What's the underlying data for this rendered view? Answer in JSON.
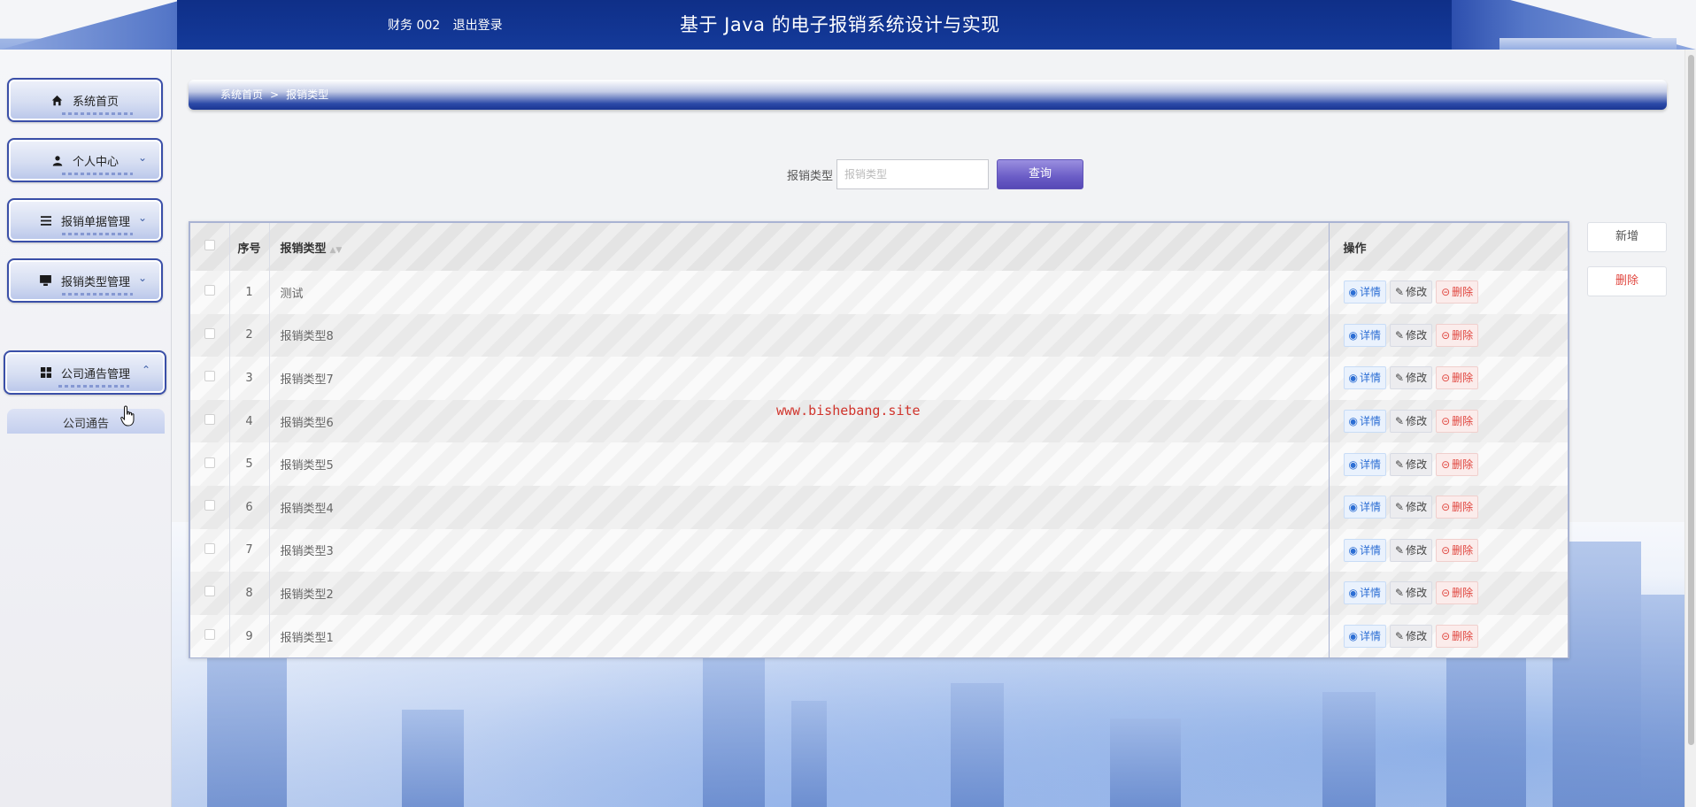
{
  "header": {
    "user": "财务 002",
    "logout": "退出登录",
    "title": "基于 Java 的电子报销系统设计与实现"
  },
  "sidebar": {
    "items": [
      {
        "label": "系统首页",
        "icon": "home-icon"
      },
      {
        "label": "个人中心",
        "icon": "user-icon"
      },
      {
        "label": "报销单据管理",
        "icon": "list-icon"
      },
      {
        "label": "报销类型管理",
        "icon": "monitor-icon"
      },
      {
        "label": "公司通告管理",
        "icon": "grid-icon"
      }
    ],
    "submenu": "公司通告"
  },
  "breadcrumb": {
    "home": "系统首页",
    "separator": ">",
    "current": "报销类型"
  },
  "search": {
    "label": "报销类型",
    "placeholder": "报销类型",
    "button": "查询"
  },
  "table": {
    "headers": {
      "index": "序号",
      "type": "报销类型",
      "ops": "操作"
    },
    "ops": {
      "detail": "详情",
      "edit": "修改",
      "delete": "删除"
    },
    "rows": [
      {
        "index": "1",
        "type": "测试"
      },
      {
        "index": "2",
        "type": "报销类型8"
      },
      {
        "index": "3",
        "type": "报销类型7"
      },
      {
        "index": "4",
        "type": "报销类型6"
      },
      {
        "index": "5",
        "type": "报销类型5"
      },
      {
        "index": "6",
        "type": "报销类型4"
      },
      {
        "index": "7",
        "type": "报销类型3"
      },
      {
        "index": "8",
        "type": "报销类型2"
      },
      {
        "index": "9",
        "type": "报销类型1"
      }
    ]
  },
  "actions": {
    "add": "新增",
    "delete": "删除"
  },
  "watermark": "www.bishebang.site",
  "colors": {
    "header": "#143a9a",
    "accent": "#6a5cc6",
    "danger": "#e0453e",
    "link": "#2c6ed4"
  }
}
